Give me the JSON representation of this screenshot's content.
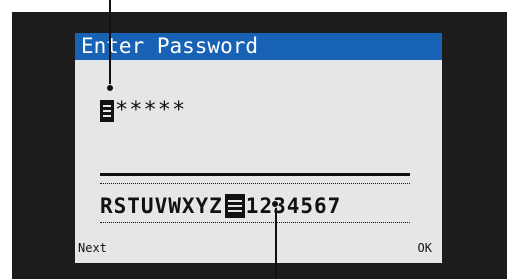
{
  "screen": {
    "title": "Enter Password",
    "password_value": "*****",
    "charset_before_cursor": "RSTUVWXYZ",
    "charset_after_cursor": "1234567",
    "softkeys": {
      "left_label": "Next",
      "right_label": "OK"
    }
  },
  "colors": {
    "title_bar": "#1762b4",
    "screen_background": "#e6e6e6",
    "bezel": "#1c1c1c",
    "text": "#111111"
  },
  "icons": {
    "password_cursor": "text-cursor-block-icon",
    "charset_cursor": "selection-cursor-block-icon"
  }
}
